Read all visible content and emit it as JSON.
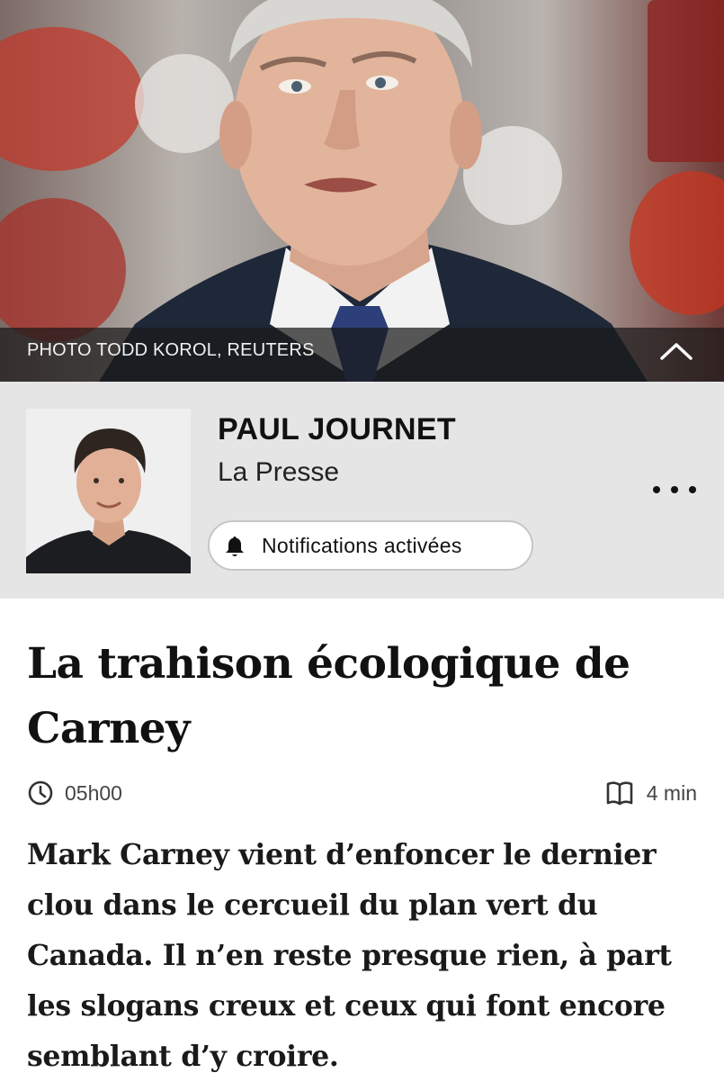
{
  "hero": {
    "photo_credit": "PHOTO TODD KOROL, REUTERS",
    "collapse_icon": "chevron-up-icon"
  },
  "author": {
    "name": "PAUL JOURNET",
    "outlet": "La Presse",
    "notifications_label": "Notifications activées",
    "notifications_icon": "bell-icon",
    "more_icon": "more-options-icon"
  },
  "article": {
    "headline": "La trahison écologique de Carney",
    "published_time": "05h00",
    "reading_time": "4 min",
    "lede": "Mark Carney vient d’enfoncer le dernier clou dans le cercueil du plan vert du Canada. Il n’en reste presque rien, à part les slogans creux et ceux qui font encore semblant d’y croire."
  },
  "colors": {
    "author_panel_bg": "#e5e5e5",
    "caption_bar_bg": "#191919",
    "text": "#111111"
  }
}
